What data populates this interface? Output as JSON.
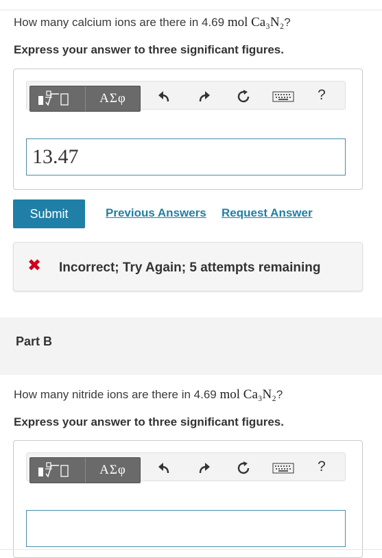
{
  "partA": {
    "question_text": "How many calcium ions are there in 4.69 ",
    "question_math": "mol Ca₃N₂",
    "question_end": "?",
    "instruction": "Express your answer to three significant figures.",
    "toolbar": {
      "greek_label": "ΑΣφ",
      "help_label": "?"
    },
    "answer_value": "13.47",
    "submit_label": "Submit",
    "previous_answers_label": "Previous Answers",
    "request_answer_label": "Request Answer",
    "feedback_text": "Incorrect; Try Again; 5 attempts remaining",
    "feedback_icon": "✖"
  },
  "partB": {
    "title": "Part B",
    "question_text": "How many nitride ions are there in 4.69 ",
    "question_math": "mol Ca₃N₂",
    "question_end": "?",
    "instruction": "Express your answer to three significant figures.",
    "toolbar": {
      "greek_label": "ΑΣφ",
      "help_label": "?"
    },
    "answer_value": ""
  },
  "colors": {
    "accent": "#1f7fa6",
    "error": "#d0021b",
    "toolbar_dark": "#6a6a6a"
  }
}
